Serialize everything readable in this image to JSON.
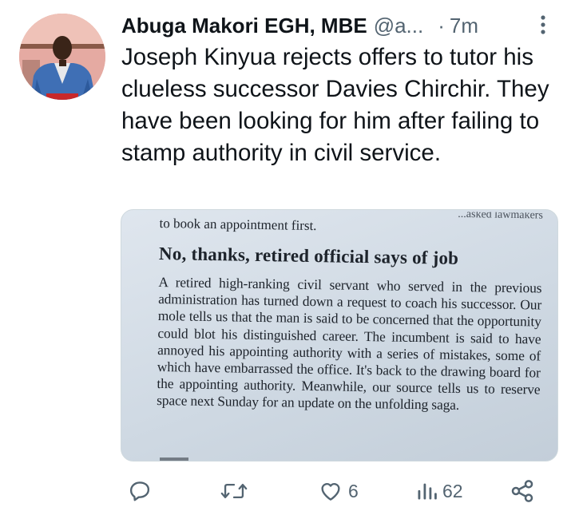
{
  "tweet": {
    "author_name": "Abuga Makori EGH, MBE",
    "author_handle": "@a...",
    "separator": "·",
    "time": "7m",
    "text": "Joseph Kinyua rejects offers to tutor his clueless successor Davies Chirchir. They have been looking for him after failing to stamp authority in civil service."
  },
  "media": {
    "previous_line_cut": "...asked lawmakers",
    "previous_line": "to book an appointment first.",
    "headline": "No, thanks, retired official says of job",
    "body": "A retired high-ranking civil servant who served in the previous administration has turned down a request to coach his successor. Our mole tells us that the man is said to be concerned that the opportunity could blot his distinguished career. The incumbent is said to have annoyed his appointing authority with a series of mistakes, some of which have embarrassed the office. It's back to the drawing board for the appointing authority. Meanwhile, our source tells us to reserve space next Sunday for an update on the unfolding saga."
  },
  "actions": {
    "reply_count": "",
    "retweet_count": "",
    "like_count": "6",
    "views_count": "62"
  },
  "icons": {
    "more": "more-vertical-icon",
    "reply": "reply-icon",
    "retweet": "retweet-icon",
    "like": "heart-icon",
    "views": "views-icon",
    "share": "share-icon"
  },
  "colors": {
    "text": "#0f1419",
    "secondary": "#536471",
    "border": "#cfd9de"
  }
}
